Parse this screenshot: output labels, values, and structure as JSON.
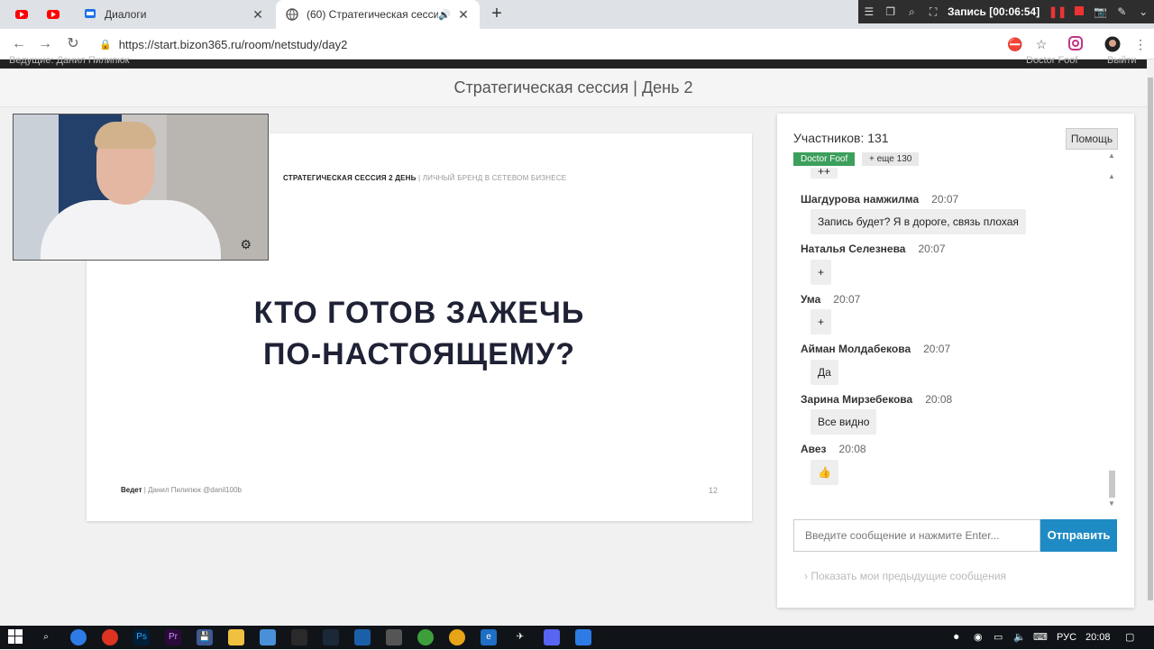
{
  "browser": {
    "tabs": [
      {
        "title": "Диалоги",
        "close": "✕"
      },
      {
        "title": "(60) Стратегическая сессия |",
        "close": "✕"
      }
    ],
    "new_tab": "+",
    "url": "https://start.bizon365.ru/room/netstudy/day2"
  },
  "recorder": {
    "label": "Запись [00:06:54]"
  },
  "page": {
    "top_left": "Ведущие: Данил Пилипюк",
    "top_user": "Doctor Foof",
    "top_exit": "Выйти",
    "title": "Стратегическая сессия | День 2"
  },
  "slide": {
    "header_bold": "СТРАТЕГИЧЕСКАЯ СЕССИЯ 2 ДЕНЬ",
    "header_rest": " | ЛИЧНЫЙ БРЕНД В СЕТЕВОМ БИЗНЕСЕ",
    "title_line1": "КТО ГОТОВ ЗАЖЕЧЬ",
    "title_line2": "ПО-НАСТОЯЩЕМУ?",
    "footer_bold": "Ведет",
    "footer_rest": " | Данил Пилипюк @danil100b",
    "page_number": "12"
  },
  "chat": {
    "participants": "Участников: 131",
    "help": "Помощь",
    "current_user": "Doctor Foof",
    "more_users": "+ еще 130",
    "partial_bubble": "++",
    "messages": [
      {
        "name": "Шагдурова намжилма",
        "time": "20:07",
        "text": "Запись будет? Я в дороге, связь плохая"
      },
      {
        "name": "Наталья Селезнева",
        "time": "20:07",
        "text": "+"
      },
      {
        "name": "Ума",
        "time": "20:07",
        "text": "+"
      },
      {
        "name": "Айман Молдабекова",
        "time": "20:07",
        "text": "Да"
      },
      {
        "name": "Зарина Мирзебекова",
        "time": "20:08",
        "text": "Все видно"
      },
      {
        "name": "Авез",
        "time": "20:08",
        "text": "👍"
      }
    ],
    "input_placeholder": "Введите сообщение и нажмите Enter...",
    "send": "Отправить",
    "show_previous": "Показать мои предыдущие сообщения"
  },
  "taskbar": {
    "lang": "РУС",
    "time": "20:08"
  }
}
